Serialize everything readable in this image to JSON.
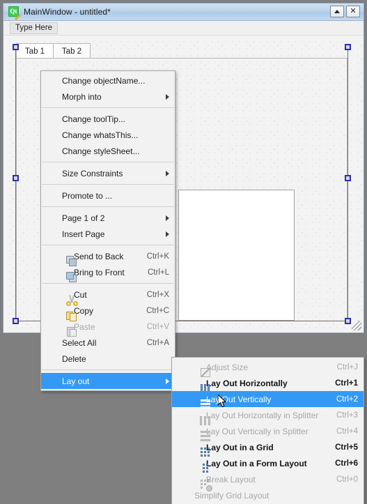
{
  "window": {
    "title": "MainWindow - untitled*",
    "app_icon": "qt-designer-icon",
    "buttons": [
      {
        "name": "restore-button",
        "glyph": ""
      },
      {
        "name": "close-button",
        "glyph": "✕"
      }
    ]
  },
  "menubar": {
    "type_here": "Type Here"
  },
  "form": {
    "tabs": [
      {
        "label": "Tab 1",
        "selected": true
      },
      {
        "label": "Tab 2",
        "selected": false
      }
    ]
  },
  "context_menu": {
    "items": [
      {
        "label": "Change objectName...",
        "accel": "",
        "icon": "",
        "submenu": false,
        "disabled": false,
        "highlighted": false
      },
      {
        "label": "Morph into",
        "accel": "",
        "icon": "",
        "submenu": true,
        "disabled": false,
        "highlighted": false
      },
      {
        "separator": true
      },
      {
        "label": "Change toolTip...",
        "accel": "",
        "icon": "",
        "submenu": false,
        "disabled": false,
        "highlighted": false
      },
      {
        "label": "Change whatsThis...",
        "accel": "",
        "icon": "",
        "submenu": false,
        "disabled": false,
        "highlighted": false
      },
      {
        "label": "Change styleSheet...",
        "accel": "",
        "icon": "",
        "submenu": false,
        "disabled": false,
        "highlighted": false
      },
      {
        "separator": true
      },
      {
        "label": "Size Constraints",
        "accel": "",
        "icon": "",
        "submenu": true,
        "disabled": false,
        "highlighted": false
      },
      {
        "separator": true
      },
      {
        "label": "Promote to ...",
        "accel": "",
        "icon": "",
        "submenu": false,
        "disabled": false,
        "highlighted": false
      },
      {
        "separator": true
      },
      {
        "label": "Page 1 of 2",
        "accel": "",
        "icon": "",
        "submenu": true,
        "disabled": false,
        "highlighted": false
      },
      {
        "label": "Insert Page",
        "accel": "",
        "icon": "",
        "submenu": true,
        "disabled": false,
        "highlighted": false
      },
      {
        "separator": true
      },
      {
        "label": "Send to Back",
        "accel": "Ctrl+K",
        "icon": "send-to-back-icon",
        "submenu": false,
        "disabled": false,
        "highlighted": false
      },
      {
        "label": "Bring to Front",
        "accel": "Ctrl+L",
        "icon": "bring-to-front-icon",
        "submenu": false,
        "disabled": false,
        "highlighted": false
      },
      {
        "separator": true
      },
      {
        "label": "Cut",
        "accel": "Ctrl+X",
        "icon": "scissors-icon",
        "submenu": false,
        "disabled": false,
        "highlighted": false
      },
      {
        "label": "Copy",
        "accel": "Ctrl+C",
        "icon": "copy-icon",
        "submenu": false,
        "disabled": false,
        "highlighted": false
      },
      {
        "label": "Paste",
        "accel": "Ctrl+V",
        "icon": "paste-icon",
        "submenu": false,
        "disabled": true,
        "highlighted": false
      },
      {
        "label": "Select All",
        "accel": "Ctrl+A",
        "icon": "",
        "submenu": false,
        "disabled": false,
        "highlighted": false
      },
      {
        "label": "Delete",
        "accel": "",
        "icon": "",
        "submenu": false,
        "disabled": false,
        "highlighted": false
      },
      {
        "separator": true
      },
      {
        "label": "Lay out",
        "accel": "",
        "icon": "",
        "submenu": true,
        "disabled": false,
        "highlighted": true
      }
    ]
  },
  "layout_submenu": {
    "items": [
      {
        "label": "Adjust Size",
        "accel": "Ctrl+J",
        "icon": "adjust-size-icon",
        "disabled": true,
        "highlighted": false
      },
      {
        "label": "Lay Out Horizontally",
        "accel": "Ctrl+1",
        "icon": "layout-horizontal-icon",
        "disabled": false,
        "highlighted": false
      },
      {
        "label": "Lay Out Vertically",
        "accel": "Ctrl+2",
        "icon": "layout-vertical-icon",
        "disabled": false,
        "highlighted": true
      },
      {
        "label": "Lay Out Horizontally in Splitter",
        "accel": "Ctrl+3",
        "icon": "splitter-horizontal-icon",
        "disabled": true,
        "highlighted": false
      },
      {
        "label": "Lay Out Vertically in Splitter",
        "accel": "Ctrl+4",
        "icon": "splitter-vertical-icon",
        "disabled": true,
        "highlighted": false
      },
      {
        "label": "Lay Out in a Grid",
        "accel": "Ctrl+5",
        "icon": "layout-grid-icon",
        "disabled": false,
        "highlighted": false
      },
      {
        "label": "Lay Out in a Form Layout",
        "accel": "Ctrl+6",
        "icon": "layout-form-icon",
        "disabled": false,
        "highlighted": false
      },
      {
        "label": "Break Layout",
        "accel": "Ctrl+0",
        "icon": "break-layout-icon",
        "disabled": true,
        "highlighted": false
      },
      {
        "label": "Simplify Grid Layout",
        "accel": "",
        "icon": "",
        "disabled": true,
        "highlighted": false
      }
    ]
  },
  "colors": {
    "highlight": "#3399f5",
    "menu_bg": "#f2f2f2",
    "titlebar": "#bcd4ec",
    "selection_handle": "#2f2fa8",
    "desktop": "#7f7f7f"
  }
}
